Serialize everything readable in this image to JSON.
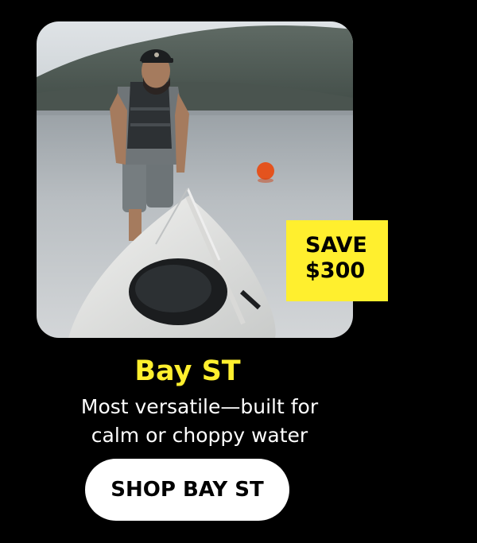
{
  "product": {
    "badge_line1": "SAVE",
    "badge_line2": "$300",
    "title": "Bay ST",
    "description_line1": "Most versatile—built for",
    "description_line2": "calm or choppy water",
    "cta_label": "SHOP BAY ST"
  },
  "colors": {
    "background": "#000000",
    "accent": "#FFEF2E",
    "text": "#FFFFFF",
    "button_bg": "#FFFFFF",
    "button_text": "#000000"
  }
}
